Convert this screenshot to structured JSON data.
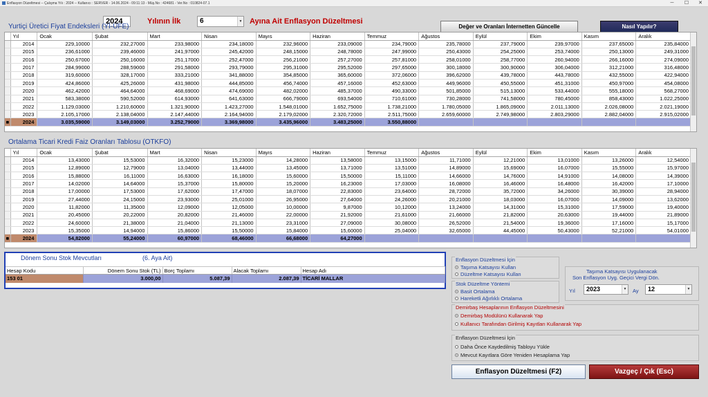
{
  "titlebar": {
    "text": "Enflasyon Düzeltmesi   --  Çalışma Yılı : 2024   --  Kullanıcı : SERVER  -  14.06.2024  -  09:11:13  -  Müş.No : 424681  -  Ver.No : 010824-07.1",
    "minimize": "─",
    "maximize": "☐",
    "close": "✕"
  },
  "header": {
    "year_value": "2024",
    "year_suffix": "Yılının İlk",
    "month_value": "6",
    "title_suffix": "Ayına Ait Enflasyon Düzeltmesi",
    "update_button": "Değer ve Oranları İnternetten Güncelle",
    "howto_button": "Nasıl Yapılır?"
  },
  "ufe": {
    "title": "Yurtiçi Üretici Fiyat Endeksleri (Yİ-ÜFE)",
    "columns": [
      "Yıl",
      "Ocak",
      "Şubat",
      "Mart",
      "Nisan",
      "Mayıs",
      "Haziran",
      "Temmuz",
      "Ağustos",
      "Eylül",
      "Ekim",
      "Kasım",
      "Aralık"
    ],
    "rows": [
      [
        "2014",
        "229,10000",
        "232,27000",
        "233,98000",
        "234,18000",
        "232,96000",
        "233,09000",
        "234,79000",
        "235,78000",
        "237,79000",
        "239,97000",
        "237,65000",
        "235,84000"
      ],
      [
        "2015",
        "236,61000",
        "239,46000",
        "241,97000",
        "245,42000",
        "248,15000",
        "248,78000",
        "247,99000",
        "250,43000",
        "254,25000",
        "253,74000",
        "250,13000",
        "249,31000"
      ],
      [
        "2016",
        "250,67000",
        "250,16000",
        "251,17000",
        "252,47000",
        "256,21000",
        "257,27000",
        "257,81000",
        "258,01000",
        "258,77000",
        "260,94000",
        "266,16000",
        "274,09000"
      ],
      [
        "2017",
        "284,99000",
        "288,59000",
        "291,58000",
        "293,79000",
        "295,31000",
        "295,52000",
        "297,65000",
        "300,18000",
        "300,90000",
        "306,04000",
        "312,21000",
        "316,48000"
      ],
      [
        "2018",
        "319,60000",
        "328,17000",
        "333,21000",
        "341,88000",
        "354,85000",
        "365,60000",
        "372,06000",
        "396,62000",
        "439,78000",
        "443,78000",
        "432,55000",
        "422,94000"
      ],
      [
        "2019",
        "424,86000",
        "425,26000",
        "431,98000",
        "444,85000",
        "456,74000",
        "457,16000",
        "452,63000",
        "449,96000",
        "450,55000",
        "451,31000",
        "450,97000",
        "454,08000"
      ],
      [
        "2020",
        "462,42000",
        "464,64000",
        "468,69000",
        "474,69000",
        "482,02000",
        "485,37000",
        "490,33000",
        "501,85000",
        "515,13000",
        "533,44000",
        "555,18000",
        "568,27000"
      ],
      [
        "2021",
        "583,38000",
        "590,52000",
        "614,93000",
        "641,63000",
        "666,79000",
        "693,54000",
        "710,61000",
        "730,28000",
        "741,58000",
        "780,45000",
        "858,43000",
        "1.022,25000"
      ],
      [
        "2022",
        "1.129,03000",
        "1.210,60000",
        "1.321,90000",
        "1.423,27000",
        "1.548,01000",
        "1.652,75000",
        "1.738,21000",
        "1.780,05000",
        "1.865,09000",
        "2.011,13000",
        "2.026,08000",
        "2.021,19000"
      ],
      [
        "2023",
        "2.105,17000",
        "2.138,04000",
        "2.147,44000",
        "2.164,94000",
        "2.179,02000",
        "2.320,72000",
        "2.511,75000",
        "2.659,60000",
        "2.749,98000",
        "2.803,29000",
        "2.882,04000",
        "2.915,02000"
      ],
      [
        "2024",
        "3.035,59000",
        "3.149,03000",
        "3.252,79000",
        "3.369,98000",
        "3.435,96000",
        "3.483,25000",
        "3.550,88000",
        "",
        "",
        "",
        "",
        ""
      ]
    ]
  },
  "otkfo": {
    "title": "Ortalama Ticari Kredi Faiz Oranları Tablosu (OTKFO)",
    "columns": [
      "Yıl",
      "Ocak",
      "Şubat",
      "Mart",
      "Nisan",
      "Mayıs",
      "Haziran",
      "Temmuz",
      "Ağustos",
      "Eylül",
      "Ekim",
      "Kasım",
      "Aralık"
    ],
    "rows": [
      [
        "2014",
        "13,43000",
        "15,53000",
        "16,32000",
        "15,23000",
        "14,28000",
        "13,58000",
        "13,15000",
        "11,71000",
        "12,21000",
        "13,01000",
        "13,26000",
        "12,54000"
      ],
      [
        "2015",
        "12,89000",
        "12,79000",
        "13,04000",
        "13,44000",
        "13,45000",
        "13,71000",
        "13,51000",
        "14,89000",
        "15,69000",
        "16,07000",
        "15,55000",
        "15,97000"
      ],
      [
        "2016",
        "15,88000",
        "16,11000",
        "16,63000",
        "16,18000",
        "15,60000",
        "15,50000",
        "15,11000",
        "14,66000",
        "14,76000",
        "14,91000",
        "14,08000",
        "14,39000"
      ],
      [
        "2017",
        "14,02000",
        "14,64000",
        "15,37000",
        "15,80000",
        "15,20000",
        "16,23000",
        "17,03000",
        "16,08000",
        "16,46000",
        "16,48000",
        "16,42000",
        "17,10000"
      ],
      [
        "2018",
        "17,00000",
        "17,53000",
        "17,62000",
        "17,47000",
        "18,07000",
        "22,83000",
        "23,64000",
        "28,72000",
        "35,72000",
        "34,26000",
        "30,39000",
        "28,94000"
      ],
      [
        "2019",
        "27,44000",
        "24,15000",
        "23,93000",
        "25,01000",
        "26,95000",
        "27,64000",
        "24,26000",
        "20,21000",
        "18,03000",
        "16,07000",
        "14,09000",
        "13,62000"
      ],
      [
        "2020",
        "11,82000",
        "11,35000",
        "12,09000",
        "12,05000",
        "10,00000",
        "9,87000",
        "10,12000",
        "13,24000",
        "14,31000",
        "15,31000",
        "17,59000",
        "19,40000"
      ],
      [
        "2021",
        "20,45000",
        "20,22000",
        "20,82000",
        "21,46000",
        "22,00000",
        "21,92000",
        "21,61000",
        "21,66000",
        "21,82000",
        "20,63000",
        "19,44000",
        "21,89000"
      ],
      [
        "2022",
        "24,60000",
        "21,38000",
        "21,04000",
        "21,13000",
        "23,31000",
        "27,09000",
        "30,08000",
        "26,52000",
        "21,54000",
        "19,36000",
        "17,16000",
        "15,17000"
      ],
      [
        "2023",
        "15,35000",
        "14,94000",
        "15,86000",
        "15,50000",
        "15,84000",
        "15,60000",
        "25,04000",
        "32,65000",
        "44,45000",
        "50,43000",
        "52,21000",
        "54,01000"
      ],
      [
        "2024",
        "54,82000",
        "55,24000",
        "60,97000",
        "68,46000",
        "66,68000",
        "64,27000",
        "",
        "",
        "",
        "",
        "",
        ""
      ]
    ]
  },
  "stock": {
    "title": "Dönem Sonu Stok Mevcutları",
    "subtitle": "(6. Aya Ait)",
    "columns": [
      "Hesap Kodu",
      "Dönem Sonu Stok (TL)",
      "Borç Toplamı",
      "Alacak Toplamı",
      "Hesap Adı"
    ],
    "row": [
      "153 01",
      "3.000,00",
      "5.087,39",
      "2.087,39",
      "TİCARİ MALLAR"
    ]
  },
  "options": {
    "inflation_group": {
      "title": "Enflasyon Düzeltmesi İçin",
      "items": [
        "Taşıma Katsayısı Kullan",
        "Düzeltme Katsayısı Kullan"
      ]
    },
    "stock_method_group": {
      "title": "Stok Düzeltme Yöntemi",
      "items": [
        "Basit Ortalama",
        "Hareketli Ağırlıklı Ortalama"
      ]
    },
    "fixed_asset_group": {
      "title": "Demirbaş Hesaplarının  Enflasyon Düzeltmesini",
      "items": [
        "Demirbaş Modülünü Kullanarak Yap",
        "Kullanıcı Tarafından Girilmiş Kayıtları Kullanarak Yap"
      ]
    },
    "recalc_group": {
      "title": "Enflasyon Düzeltmesi İçin",
      "items": [
        "Daha Önce Kaydedilmiş Tabloyu Yükle",
        "Mevcut Kayıtlara Göre Yeniden Hesaplama Yap"
      ]
    },
    "coefficient": {
      "line1": "Taşıma Katsayısı Uygulanacak",
      "line2": "Son Enflasyon Uyg. Geçici Vergi Dön.",
      "year_label": "Yıl",
      "year_value": "2023",
      "month_label": "Ay",
      "month_value": "12"
    }
  },
  "actions": {
    "run_button": "Enflasyon Düzeltmesi (F2)",
    "cancel_button": "Vazgeç / Çık (Esc)"
  }
}
